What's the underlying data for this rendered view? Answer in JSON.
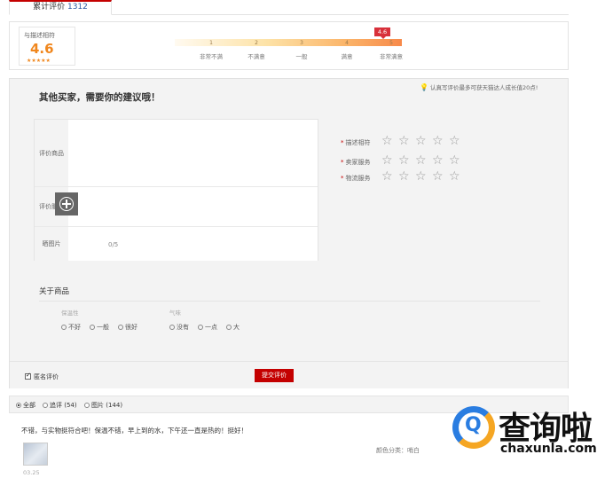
{
  "tab": {
    "label": "累计评价",
    "count": "1312"
  },
  "summary": {
    "score_label": "与描述相符",
    "score": "4.6",
    "stars": "★★★★★",
    "bar_marker": "4.6",
    "bar_numbers": [
      "1",
      "2",
      "3",
      "4",
      "5"
    ],
    "bar_labels": [
      "非常不满",
      "不满意",
      "一般",
      "满意",
      "非常满意"
    ],
    "colors": {
      "accent": "#f0871e",
      "marker": "#d8303a"
    }
  },
  "feedback": {
    "title": "其他买家，需要你的建议哦！",
    "tip": "认真写评价最多可获天猫达人成长值20点!",
    "rows": [
      {
        "label": "评价商品"
      },
      {
        "label": "评价服务"
      },
      {
        "label": "晒图片"
      }
    ],
    "photo_count": "0/5",
    "ratings": [
      {
        "label": "描述相符"
      },
      {
        "label": "卖家服务"
      },
      {
        "label": "物流服务"
      }
    ],
    "about_title": "关于商品",
    "attributes": [
      {
        "name": "保温性",
        "options": [
          "不好",
          "一般",
          "很好"
        ]
      },
      {
        "name": "气味",
        "options": [
          "没有",
          "一点",
          "大"
        ]
      }
    ],
    "anonymous_label": "匿名评价",
    "submit_label": "提交评价"
  },
  "filter": {
    "items": [
      {
        "label": "全部",
        "selected": true
      },
      {
        "label": "追评 (54)",
        "selected": false
      },
      {
        "label": "图片 (144)",
        "selected": false
      }
    ]
  },
  "review": {
    "text": "不错，与实物挺符合吧！保温不错，早上到的水，下午还一直是热的！挺好！",
    "date": "03.25",
    "sku": "颜色分类：哨白"
  },
  "watermark": {
    "cn": "查询啦",
    "en": "chaxunla.com"
  },
  "icons": {
    "required": "*",
    "star": "☆",
    "bulb": "lightbulb-icon",
    "add_photo": "add-photo-icon"
  }
}
